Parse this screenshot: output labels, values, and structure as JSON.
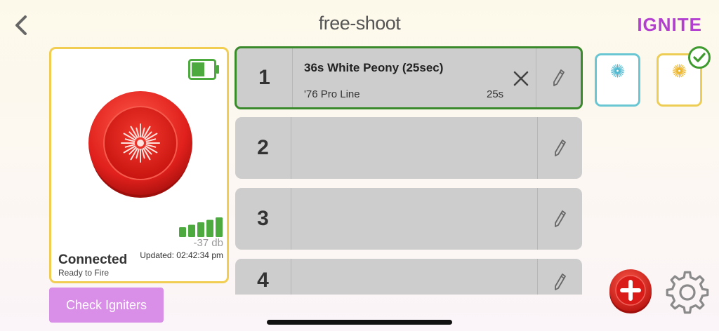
{
  "header": {
    "title": "free-shoot",
    "brand": "IGNITE"
  },
  "device": {
    "status": "Connected",
    "substatus": "Ready to Fire",
    "signal_db": "-37 db",
    "updated": "Updated: 02:42:34 pm",
    "battery_level": 0.6,
    "signal_bars": 5,
    "colors": {
      "border": "#f1cd52",
      "button": "#e0201c",
      "signal": "#4caa3e",
      "battery": "#4caa3e"
    }
  },
  "actions": {
    "check_igniters": "Check Igniters"
  },
  "cues": [
    {
      "number": "1",
      "name": "36s White Peony (25sec)",
      "product": "'76 Pro Line",
      "duration": "25s",
      "active": true
    },
    {
      "number": "2",
      "name": "",
      "product": "",
      "duration": "",
      "active": false
    },
    {
      "number": "3",
      "name": "",
      "product": "",
      "duration": "",
      "active": false
    },
    {
      "number": "4",
      "name": "",
      "product": "",
      "duration": "",
      "active": false
    }
  ],
  "tiles": [
    {
      "icon": "teal-burst-icon",
      "border": "#69c6d3",
      "color": "#4fb9d0",
      "selected": false
    },
    {
      "icon": "yellow-burst-icon",
      "border": "#eecd54",
      "color": "#edb52a",
      "selected": true
    }
  ],
  "icons": {
    "back": "chevron-left-icon",
    "clear": "close-icon",
    "edit": "pencil-icon",
    "add": "add-icon",
    "settings": "gear-icon"
  }
}
